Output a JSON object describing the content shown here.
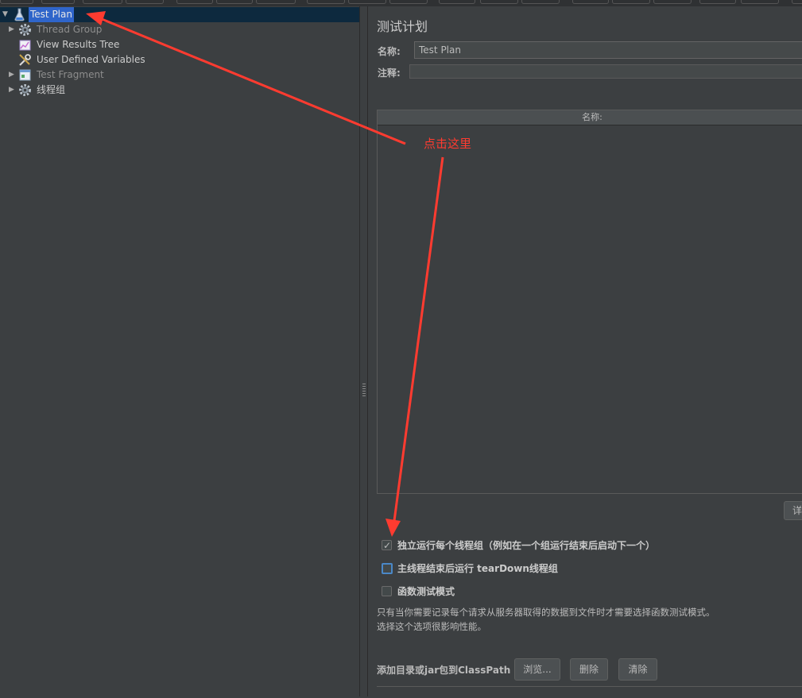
{
  "tree": {
    "items": [
      {
        "label": "Test Plan",
        "icon": "flask-icon"
      },
      {
        "label": "Thread Group",
        "icon": "gear-icon"
      },
      {
        "label": "View Results Tree",
        "icon": "chart-icon"
      },
      {
        "label": "User Defined Variables",
        "icon": "wrench-icon"
      },
      {
        "label": "Test Fragment",
        "icon": "fragment-icon"
      },
      {
        "label": "线程组",
        "icon": "gear-icon"
      }
    ]
  },
  "panel": {
    "title": "测试计划",
    "name_label": "名称:",
    "name_value": "Test Plan",
    "comment_label": "注释:",
    "comment_value": "",
    "table_header": "名称:",
    "cut_button": "详"
  },
  "options": {
    "run_each": "独立运行每个线程组（例如在一个组运行结束后启动下一个）",
    "run_each_checked": true,
    "teardown": "主线程结束后运行 tearDown线程组",
    "teardown_checked": false,
    "functional": "函数测试模式",
    "functional_checked": false,
    "note_line1": "只有当你需要记录每个请求从服务器取得的数据到文件时才需要选择函数测试模式。",
    "note_line2": "选择这个选项很影响性能。"
  },
  "classpath": {
    "label": "添加目录或jar包到ClassPath",
    "browse": "浏览...",
    "delete": "删除",
    "clear": "清除"
  },
  "annotation": {
    "text": "点击这里",
    "color": "#ff3b30"
  },
  "colors": {
    "background": "#3c3f41",
    "selection": "#2f65ca",
    "selection_row": "#0d293e"
  }
}
